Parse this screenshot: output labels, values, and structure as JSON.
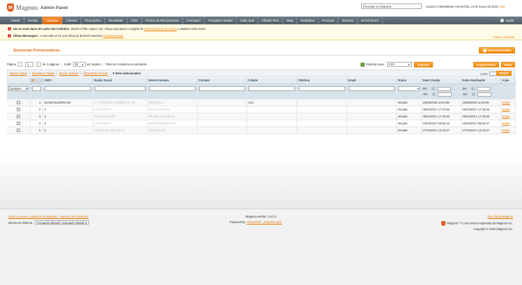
{
  "header": {
    "logo_mark": "M",
    "logo_text": "Magento",
    "logo_sub": "Admin Panel",
    "search_placeholder": "Procurar no Sistema",
    "user_text": "Usuário: intDevMaster  |  terça-feira, 24 de março de 2020  |",
    "logout": "Sair"
  },
  "nav": {
    "items": [
      "Painel",
      "Vendas",
      "Catálogo",
      "Clientes",
      "Promoções",
      "Newsletter",
      "CMS",
      "Pontos de Recompensa",
      "LiveAgent",
      "Templates Master",
      "Daily deal",
      "Afiliado Plus",
      "Blog",
      "Relatórios",
      "Procurar",
      "Sistema",
      "MAGFlames"
    ],
    "active_index": 2,
    "help": "Ajuda"
  },
  "messages": {
    "m1_bold": "Um ou mais tipos de cache são inválidos:",
    "m1_text": "Blocks HTML output, Fpc. Clique aqui para ir a página de",
    "m1_link": "Gerenciamento de Cache",
    "m1_tail": "e atualizar todo cache.",
    "m2_bold": "Última Mensagem:",
    "m2_text": "A new add-on for your Shop by BrainOf extension",
    "m2_link": "Continuar lendo",
    "link_all": "Todas",
    "link_sep": "|",
    "link_close": "Cancelar"
  },
  "page": {
    "title": "Gerenciar Fornecedores",
    "create_button": "Criar Fornecedor",
    "reset_filter": "Limpar Filtros",
    "search_button": "Filtrar"
  },
  "pager": {
    "page_label": "Página",
    "page_value": "1",
    "of_pages": "de 1 páginas",
    "show_label": "Exibir",
    "per_page": "20",
    "per_page_label": "por página",
    "total": "Total de 5 registros encontrados"
  },
  "export": {
    "label": "Exportar para:",
    "format": "CSV",
    "button": "Exportar"
  },
  "mass": {
    "select_all": "Marcar Todos",
    "unselect_all": "Desmarcar Todos",
    "select_visible": "Marcar Visíveis",
    "unselect_visible": "Desmarcar Visíveis",
    "selected": "0 itens selecionados",
    "actions_label": "Ações",
    "submit": "Enviar"
  },
  "grid": {
    "columns": [
      "",
      "ID",
      "CNPJ",
      "Razão Social",
      "Nome Fantasia",
      "Contato",
      "Cidade",
      "Telefone",
      "Email",
      "Status",
      "Data Criação",
      "Data Atualização",
      "Ação"
    ],
    "filter_any": "Qualquer",
    "from": "De:",
    "to": "Até:",
    "rows": [
      {
        "id": "1",
        "cnpj": "23.994.513/0001-80",
        "razao": "27 PRENSAS COMERCIO DE",
        "fantasia": "PRENSAS",
        "contato": "",
        "cidade": "JAU",
        "telefone": "",
        "email": "",
        "status": "Ativado",
        "criacao": "18/05/2016 11:54:55",
        "atualizacao": "18/05/2016 11:54:55",
        "acao": "Editar"
      },
      {
        "id": "2",
        "cnpj": "2",
        "razao": "COSTURAR",
        "fantasia": "ESTILO EM RE",
        "contato": "",
        "cidade": "",
        "telefone": "",
        "email": "",
        "status": "Ativado",
        "criacao": "05/04/2017 17:27:50",
        "atualizacao": "05/04/2017 17:32:36",
        "acao": "Editar"
      },
      {
        "id": "3",
        "cnpj": "3",
        "razao": "CASA ALEGRE",
        "fantasia": "BRASIL FORNECE",
        "contato": "",
        "cidade": "",
        "telefone": "",
        "email": "",
        "status": "Ativado",
        "criacao": "05/04/2017 17:33:30",
        "atualizacao": "05/04/2017 17:33:30",
        "acao": "Editar"
      },
      {
        "id": "4",
        "cnpj": "4",
        "razao": "SOLUTECH",
        "fantasia": "ENTREFORNECER",
        "contato": "",
        "cidade": "",
        "telefone": "",
        "email": "",
        "status": "Ativado",
        "criacao": "10/04/2017 09:50:13",
        "atualizacao": "10/04/2017 09:50:37",
        "acao": "Editar"
      },
      {
        "id": "5",
        "cnpj": "5",
        "razao": "MARIO DA SECURAS",
        "fantasia": "SEGURADO",
        "contato": "",
        "cidade": "",
        "telefone": "",
        "email": "",
        "status": "Ativado",
        "criacao": "27/04/2017 13:23:27",
        "atualizacao": "27/04/2017 13:23:27",
        "acao": "Editar"
      }
    ]
  },
  "footer": {
    "help_link": "Ajude a manter e atualizar do Magento - Reporte os Problemas",
    "lang_label": "Idioma do Sistema:",
    "lang_value": "Português (Brasil) / português (Brasil)",
    "version": "Magento versão: 1.9.2.4",
    "powered_label": "Powered By:",
    "powered_link": "ITGRATOR - Soluções Web",
    "site_link": "Site Oficial Magento",
    "trademark": "Magento™ é uma marca registrada da Magento Inc.",
    "copyright": "Copyright © 2020 Magento Inc."
  }
}
